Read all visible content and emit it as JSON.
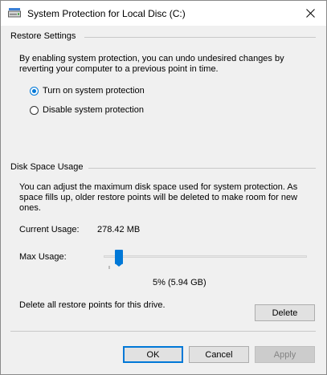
{
  "window": {
    "title": "System Protection for Local Disc (C:)"
  },
  "restore_settings": {
    "heading": "Restore Settings",
    "description": "By enabling system protection, you can undo undesired changes by reverting your computer to a previous point in time.",
    "options": [
      {
        "label": "Turn on system protection",
        "selected": true
      },
      {
        "label": "Disable system protection",
        "selected": false
      }
    ]
  },
  "disk_space": {
    "heading": "Disk Space Usage",
    "description": "You can adjust the maximum disk space used for system protection. As space fills up, older restore points will be deleted to make room for new ones.",
    "current_usage_label": "Current Usage:",
    "current_usage_value": "278.42 MB",
    "max_usage_label": "Max Usage:",
    "max_usage_percent": 5,
    "max_usage_value": "5% (5.94 GB)",
    "delete_text": "Delete all restore points for this drive.",
    "delete_label": "Delete"
  },
  "footer": {
    "ok_label": "OK",
    "cancel_label": "Cancel",
    "apply_label": "Apply"
  },
  "colors": {
    "accent": "#0078d7"
  }
}
